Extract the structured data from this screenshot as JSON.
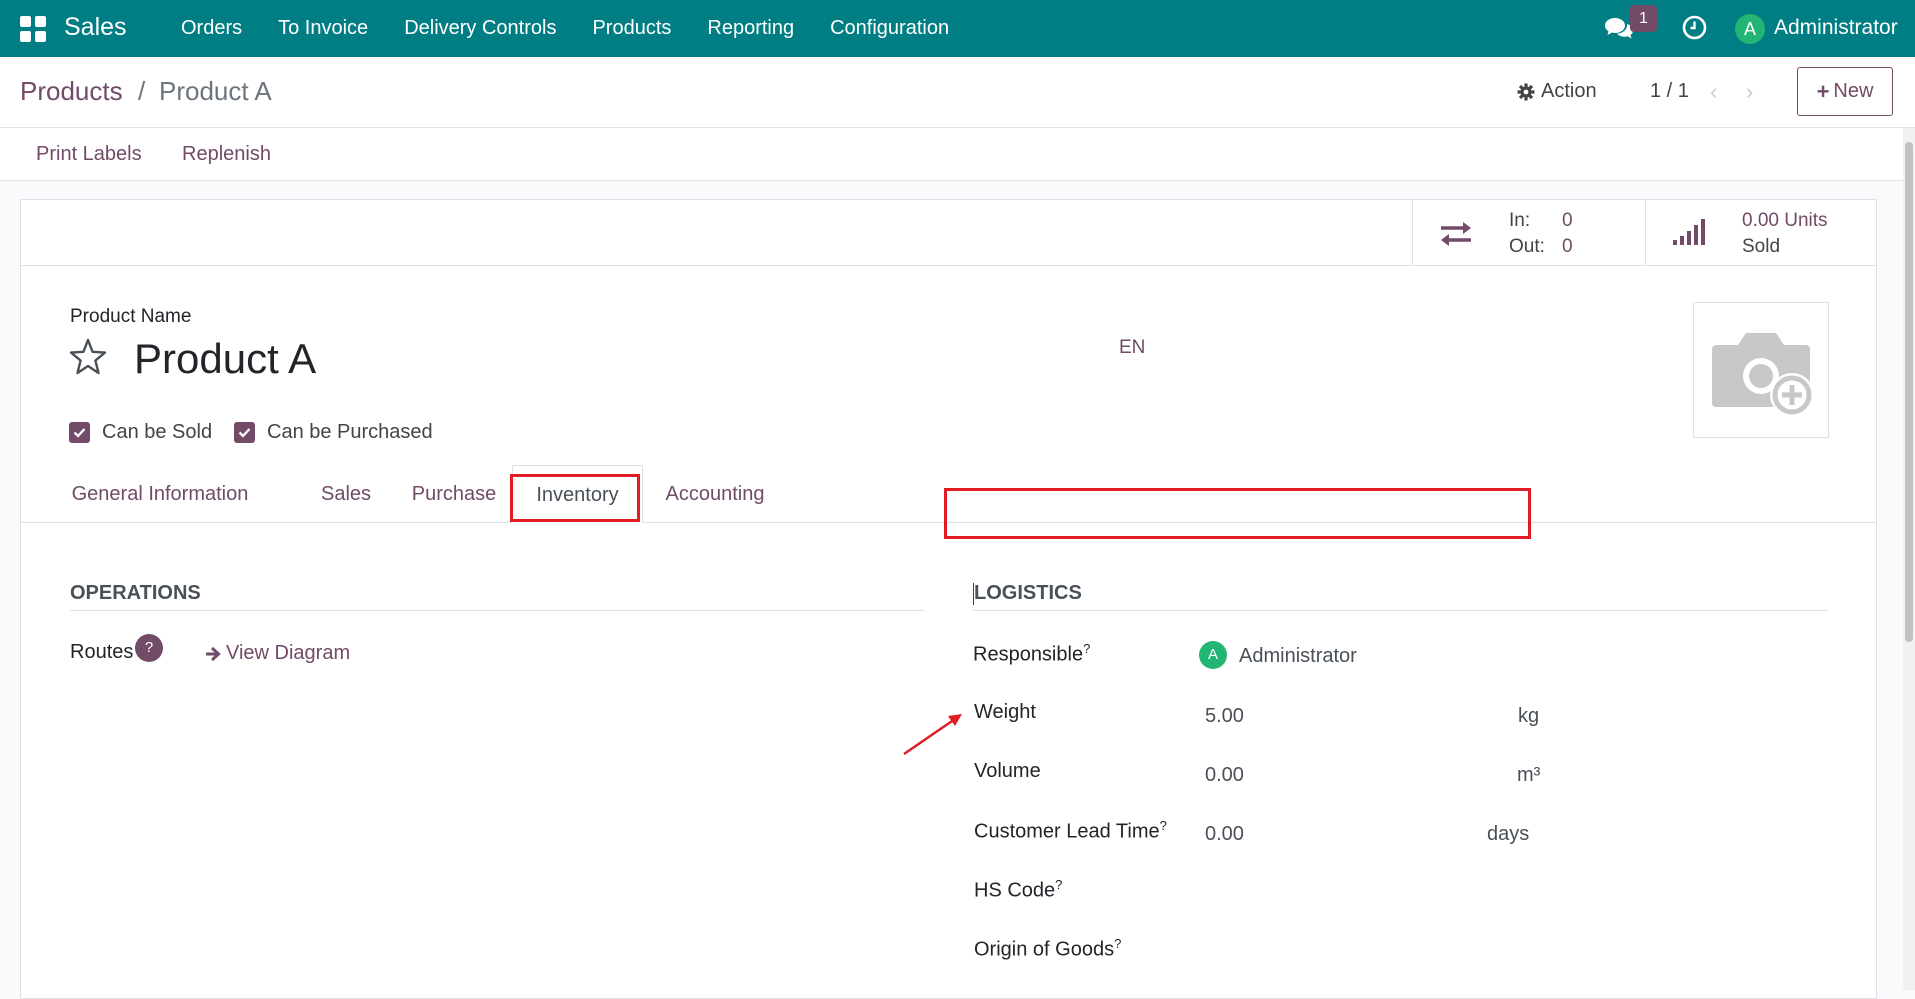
{
  "navbar": {
    "brand": "Sales",
    "menu": [
      "Orders",
      "To Invoice",
      "Delivery Controls",
      "Products",
      "Reporting",
      "Configuration"
    ],
    "chat_badge": "1",
    "user_initial": "A",
    "user_name": "Administrator",
    "color": "#017e84"
  },
  "breadcrumb": {
    "parent": "Products",
    "separator": "/",
    "current": "Product A"
  },
  "control": {
    "action_label": "Action",
    "pager": "1 / 1",
    "prev": "‹",
    "next": "›",
    "new_label": "New",
    "new_plus": "+"
  },
  "statusbar": {
    "buttons": [
      "Print Labels",
      "Replenish"
    ]
  },
  "smart_buttons": {
    "in_label": "In:",
    "in_value": "0",
    "out_label": "Out:",
    "out_value": "0",
    "sold_value": "0.00 Units",
    "sold_label": "Sold"
  },
  "product": {
    "name_label": "Product Name",
    "name": "Product A",
    "lang": "EN",
    "can_be_sold": "Can be Sold",
    "can_be_purchased": "Can be Purchased"
  },
  "tabs": [
    "General Information",
    "Sales",
    "Purchase",
    "Inventory",
    "Accounting"
  ],
  "active_tab": "Inventory",
  "operations": {
    "title": "OPERATIONS",
    "routes_label": "Routes",
    "help": "?",
    "view_diagram": "View Diagram"
  },
  "logistics": {
    "title": "LOGISTICS",
    "responsible_label": "Responsible",
    "responsible_initial": "A",
    "responsible_value": "Administrator",
    "weight_label": "Weight",
    "weight_value": "5.00",
    "weight_unit": "kg",
    "volume_label": "Volume",
    "volume_value": "0.00",
    "volume_unit": "m³",
    "lead_time_label": "Customer Lead Time",
    "lead_time_value": "0.00",
    "lead_time_unit": "days",
    "hs_code_label": "HS Code",
    "origin_label": "Origin of Goods",
    "tooltip_mark": "?"
  },
  "colors": {
    "primary": "#714b67",
    "navbar": "#017e84",
    "highlight": "#e01b24",
    "avatar": "#22b573"
  }
}
